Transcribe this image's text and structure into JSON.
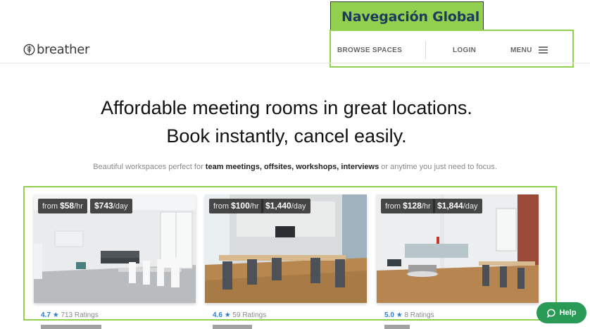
{
  "annotation": {
    "label": "Navegación Global"
  },
  "header": {
    "logo_text": "breather",
    "nav": {
      "browse": "BROWSE SPACES",
      "login": "LOGIN",
      "menu": "MENU"
    }
  },
  "hero": {
    "line1": "Affordable meeting rooms in great locations.",
    "line2": "Book instantly, cancel easily."
  },
  "subtitle": {
    "prefix": "Beautiful workspaces perfect for ",
    "k1": "team meetings",
    "sep": ", ",
    "k2": "offsites",
    "k3": "workshops",
    "k4": "interviews",
    "suffix": " or anytime you just need to focus."
  },
  "cards": [
    {
      "from_label": "from ",
      "hourly": "$58",
      "hourly_unit": "/hr",
      "daily": "$743",
      "daily_unit": "/day",
      "score": "4.7",
      "ratings": "713 Ratings"
    },
    {
      "from_label": "from ",
      "hourly": "$100",
      "hourly_unit": "/hr",
      "daily": "$1,440",
      "daily_unit": "/day",
      "score": "4.6",
      "ratings": "59 Ratings"
    },
    {
      "from_label": "from ",
      "hourly": "$128",
      "hourly_unit": "/hr",
      "daily": "$1,844",
      "daily_unit": "/day",
      "score": "5.0",
      "ratings": "8 Ratings"
    }
  ],
  "help": {
    "label": "Help"
  },
  "colors": {
    "annotation_green": "#92d050",
    "link_blue": "#2a7fd4",
    "help_green": "#2a9a57"
  },
  "icons": {
    "logo": "breather-leaf-icon",
    "menu": "hamburger-icon",
    "star": "star-icon",
    "help": "chat-bubble-icon"
  }
}
